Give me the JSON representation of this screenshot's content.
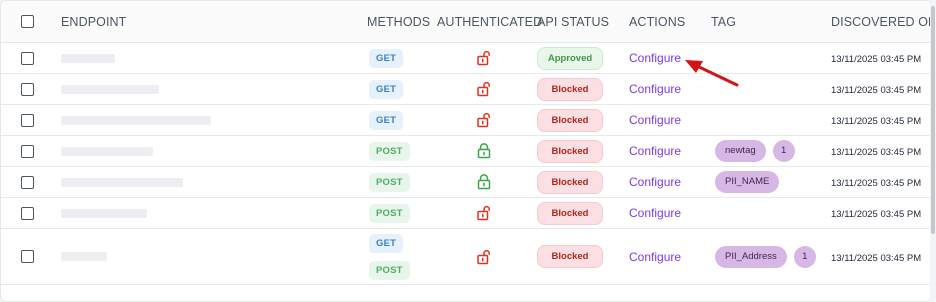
{
  "columns": {
    "endpoint": "ENDPOINT",
    "methods": "METHODS",
    "authenticated": "AUTHENTICATED",
    "api_status": "API STATUS",
    "actions": "ACTIONS",
    "tag": "TAG",
    "discovered_on": "DISCOVERED ON"
  },
  "colors": {
    "unlocked_lock": "#e0311f",
    "locked_lock": "#3aa64a",
    "arrow": "#d21414"
  },
  "rows": [
    {
      "methods": [
        "GET"
      ],
      "authenticated": false,
      "auth_icon": "lock-open-icon",
      "status": "Approved",
      "action": "Configure",
      "tags": [],
      "extra_count": "",
      "discovered": "13/11/2025 03:45 PM"
    },
    {
      "methods": [
        "GET"
      ],
      "authenticated": false,
      "auth_icon": "lock-open-icon",
      "status": "Blocked",
      "action": "Configure",
      "tags": [],
      "extra_count": "",
      "discovered": "13/11/2025 03:45 PM"
    },
    {
      "methods": [
        "GET"
      ],
      "authenticated": false,
      "auth_icon": "lock-open-icon",
      "status": "Blocked",
      "action": "Configure",
      "tags": [],
      "extra_count": "",
      "discovered": "13/11/2025 03:45 PM"
    },
    {
      "methods": [
        "POST"
      ],
      "authenticated": true,
      "auth_icon": "lock-closed-icon",
      "status": "Blocked",
      "action": "Configure",
      "tags": [
        "newtag"
      ],
      "extra_count": "1",
      "discovered": "13/11/2025 03:45 PM"
    },
    {
      "methods": [
        "POST"
      ],
      "authenticated": true,
      "auth_icon": "lock-closed-icon",
      "status": "Blocked",
      "action": "Configure",
      "tags": [
        "PII_NAME"
      ],
      "extra_count": "",
      "discovered": "13/11/2025 03:45 PM"
    },
    {
      "methods": [
        "POST"
      ],
      "authenticated": false,
      "auth_icon": "lock-open-icon",
      "status": "Blocked",
      "action": "Configure",
      "tags": [],
      "extra_count": "",
      "discovered": "13/11/2025 03:45 PM"
    },
    {
      "methods": [
        "GET",
        "POST"
      ],
      "authenticated": false,
      "auth_icon": "lock-open-icon",
      "status": "Blocked",
      "action": "Configure",
      "tags": [
        "PII_Address"
      ],
      "extra_count": "1",
      "discovered": "13/11/2025 03:45 PM"
    }
  ]
}
